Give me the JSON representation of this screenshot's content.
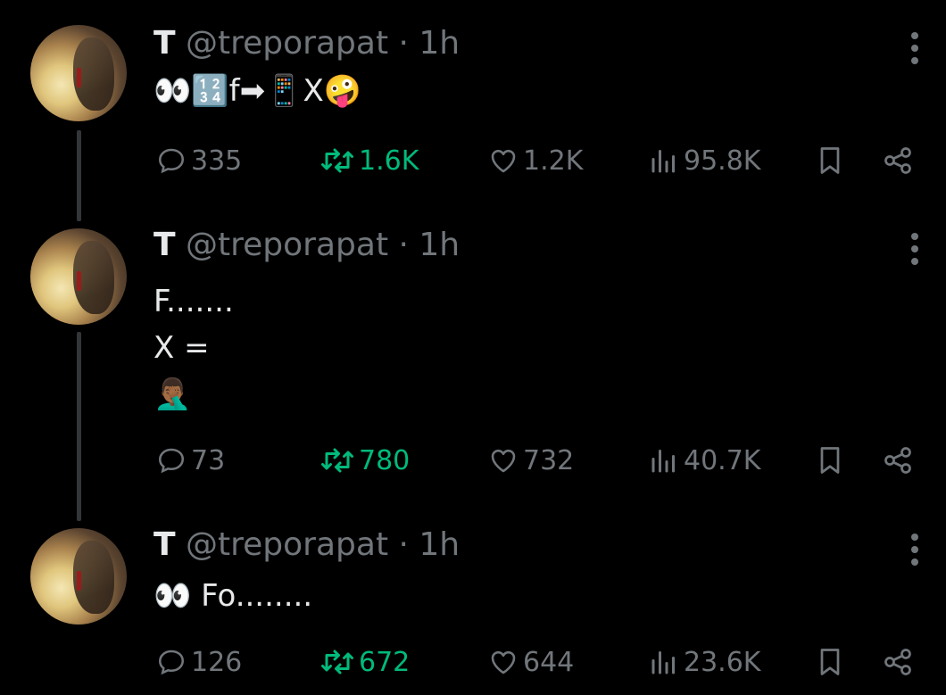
{
  "tweets": [
    {
      "display_initial": "T",
      "handle": "@treporapat",
      "time": "· 1h",
      "lines": [
        "👀🔢f➡📱X🤪"
      ],
      "replies": "335",
      "reposts": "1.6K",
      "likes": "1.2K",
      "views": "95.8K"
    },
    {
      "display_initial": "T",
      "handle": "@treporapat",
      "time": "· 1h",
      "lines": [
        "F.......",
        "X =",
        "🤦🏾‍♂️"
      ],
      "replies": "73",
      "reposts": "780",
      "likes": "732",
      "views": "40.7K"
    },
    {
      "display_initial": "T",
      "handle": "@treporapat",
      "time": "· 1h",
      "lines": [
        "👀 Fo........"
      ],
      "replies": "126",
      "reposts": "672",
      "likes": "644",
      "views": "23.6K"
    }
  ],
  "icons": {
    "reply": "reply-icon",
    "repost": "repost-icon",
    "like": "heart-icon",
    "views": "views-icon",
    "bookmark": "bookmark-icon",
    "share": "share-icon",
    "more": "more-icon"
  },
  "colors": {
    "background": "#000000",
    "text": "#e7e9ea",
    "muted": "#71767b",
    "repost_green": "#00ba7c"
  }
}
